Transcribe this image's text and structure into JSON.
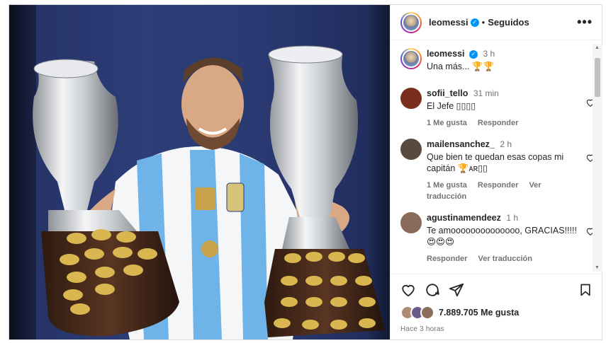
{
  "post": {
    "username": "leomessi",
    "follow_status": "Seguidos",
    "more_icon": "more-horizontal-icon",
    "caption": {
      "username": "leomessi",
      "time": "3 h",
      "text": "Una más... 🏆🏆"
    },
    "comments": [
      {
        "username": "sofii_tello",
        "time": "31 min",
        "text": "El Jefe ▯▯▯▯",
        "actions": [
          "1 Me gusta",
          "Responder"
        ],
        "avatar_color": "#7a2e1d"
      },
      {
        "username": "mailensanchez_",
        "time": "2 h",
        "text": "Que bien te quedan esas copas mi capitán 🏆ᴀʀ▯▯",
        "actions": [
          "1 Me gusta",
          "Responder",
          "Ver traducción"
        ],
        "avatar_color": "#5a4a3e"
      },
      {
        "username": "agustinamendeez",
        "time": "1 h",
        "text": "Te amoooooooooooooo, GRACIAS!!!!! 😍😍😍",
        "actions": [
          "Responder",
          "Ver traducción"
        ],
        "avatar_color": "#8a6b59"
      }
    ],
    "likes": "7.889.705 Me gusta",
    "posted_ago": "Hace 3 horas",
    "colors": {
      "accent": "#0095f6",
      "jersey_blue": "#6fb4e8"
    }
  }
}
